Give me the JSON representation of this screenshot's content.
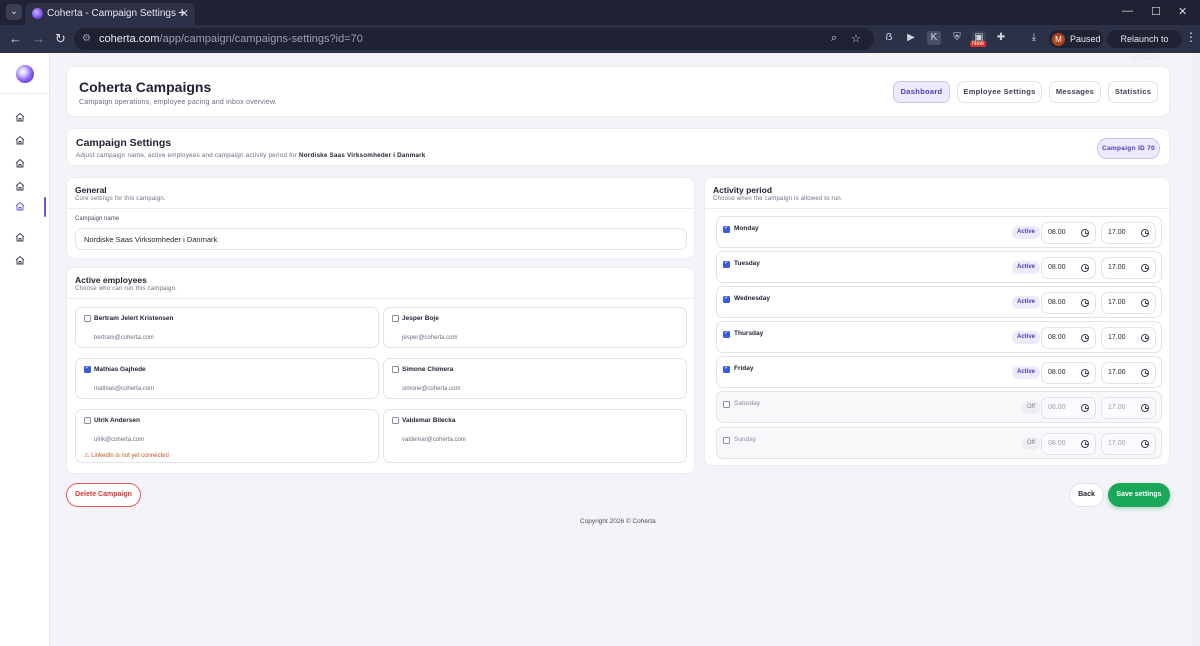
{
  "browser": {
    "tab_title": "Coherta - Campaign Settings",
    "url_host": "coherta.com",
    "url_path": "/app/campaign/campaigns-settings?id=70",
    "new_badge": "New",
    "profile_initial": "M",
    "profile_status": "Paused",
    "relaunch_label": "Relaunch to update"
  },
  "header": {
    "title": "Coherta Campaigns",
    "subtitle": "Campaign operations, employee pacing and inbox overview.",
    "nav": [
      "Dashboard",
      "Employee Settings",
      "Messages",
      "Statistics"
    ]
  },
  "settings": {
    "title": "Campaign Settings",
    "subtitle_prefix": "Adjust campaign name, active employees and campaign activity period for",
    "campaign_bold": "Nordiske Saas Virksomheder i Danmark",
    "subtitle_suffix": ".",
    "campaign_id_label": "Campaign ID 70"
  },
  "general": {
    "title": "General",
    "subtitle": "Core settings for this campaign.",
    "name_label": "Campaign name",
    "name_value": "Nordiske Saas Virksomheder i Danmark"
  },
  "employees": {
    "title": "Active employees",
    "subtitle": "Choose who can run this campaign.",
    "items": [
      {
        "name": "Bertram Jelert Kristensen",
        "email": "bertram@coherta.com",
        "checked": false,
        "warning": ""
      },
      {
        "name": "Jesper Boje",
        "email": "jesper@coherta.com",
        "checked": false,
        "warning": ""
      },
      {
        "name": "Mathias Gajhede",
        "email": "mathias@coherta.com",
        "checked": true,
        "warning": ""
      },
      {
        "name": "Simone Chimera",
        "email": "simone@coherta.com",
        "checked": false,
        "warning": ""
      },
      {
        "name": "Ulrik Andersen",
        "email": "ulrik@coherta.com",
        "checked": false,
        "warning": "LinkedIn is not yet connected"
      },
      {
        "name": "Valdemar Bilecka",
        "email": "valdemar@coherta.com",
        "checked": false,
        "warning": ""
      }
    ]
  },
  "activity": {
    "title": "Activity period",
    "subtitle": "Choose when the campaign is allowed to run.",
    "days": [
      {
        "name": "Monday",
        "checked": true,
        "status": "Active",
        "start": "08.00",
        "end": "17.00"
      },
      {
        "name": "Tuesday",
        "checked": true,
        "status": "Active",
        "start": "08.00",
        "end": "17.00"
      },
      {
        "name": "Wednesday",
        "checked": true,
        "status": "Active",
        "start": "08.00",
        "end": "17.00"
      },
      {
        "name": "Thursday",
        "checked": true,
        "status": "Active",
        "start": "08.00",
        "end": "17.00"
      },
      {
        "name": "Friday",
        "checked": true,
        "status": "Active",
        "start": "08.00",
        "end": "17.00"
      },
      {
        "name": "Saturday",
        "checked": false,
        "status": "Off",
        "start": "08.00",
        "end": "17.00"
      },
      {
        "name": "Sunday",
        "checked": false,
        "status": "Off",
        "start": "08.00",
        "end": "17.00"
      }
    ]
  },
  "actions": {
    "delete_label": "Delete Campaign",
    "back_label": "Back",
    "save_label": "Save settings"
  },
  "footer": {
    "copyright": "Copyright 2026 © Coherta"
  },
  "colors": {
    "accent": "#4a3fb8",
    "success": "#1aa75a",
    "danger": "#d23b3b",
    "warning": "#c4561c"
  }
}
